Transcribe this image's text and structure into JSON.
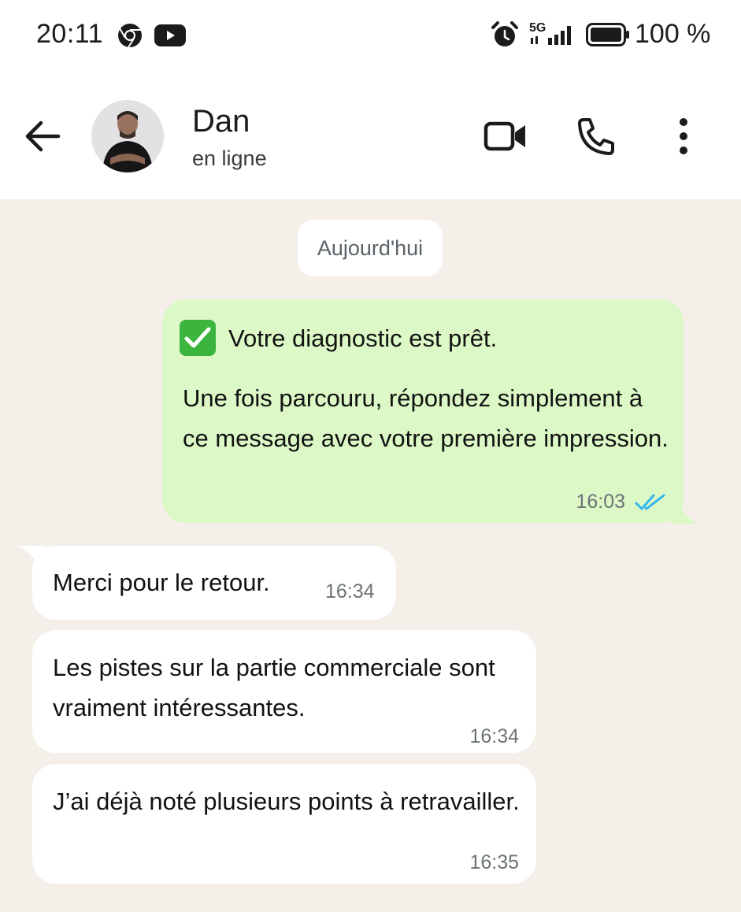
{
  "status_bar": {
    "time": "20:11",
    "network": "5G",
    "battery": "100 %",
    "icons": [
      "chrome-icon",
      "youtube-icon",
      "alarm-icon",
      "signal-icon",
      "battery-icon"
    ]
  },
  "header": {
    "contact_name": "Dan",
    "contact_status": "en ligne",
    "icons": [
      "back-arrow-icon",
      "video-call-icon",
      "phone-icon",
      "more-options-icon"
    ]
  },
  "chat": {
    "date_chip": "Aujourd'hui",
    "outgoing": {
      "line1": "Votre diagnostic est prêt.",
      "body": "Une fois parcouru, répondez simplement à ce message avec votre première impression.",
      "time": "16:03",
      "status": "read"
    },
    "incoming": [
      {
        "text": "Merci pour le retour.",
        "time": "16:34"
      },
      {
        "text": "Les pistes sur la partie commerciale sont vraiment intéressantes.",
        "time": "16:34"
      },
      {
        "text": "J’ai déjà noté plusieurs points à retravailler.",
        "time": "16:35"
      }
    ]
  },
  "colors": {
    "outgoing_bubble": "#dcf8c6",
    "incoming_bubble": "#ffffff",
    "chat_background": "#f4efe8",
    "read_ticks": "#34b7f1",
    "check_emoji": "#3cb53f"
  }
}
